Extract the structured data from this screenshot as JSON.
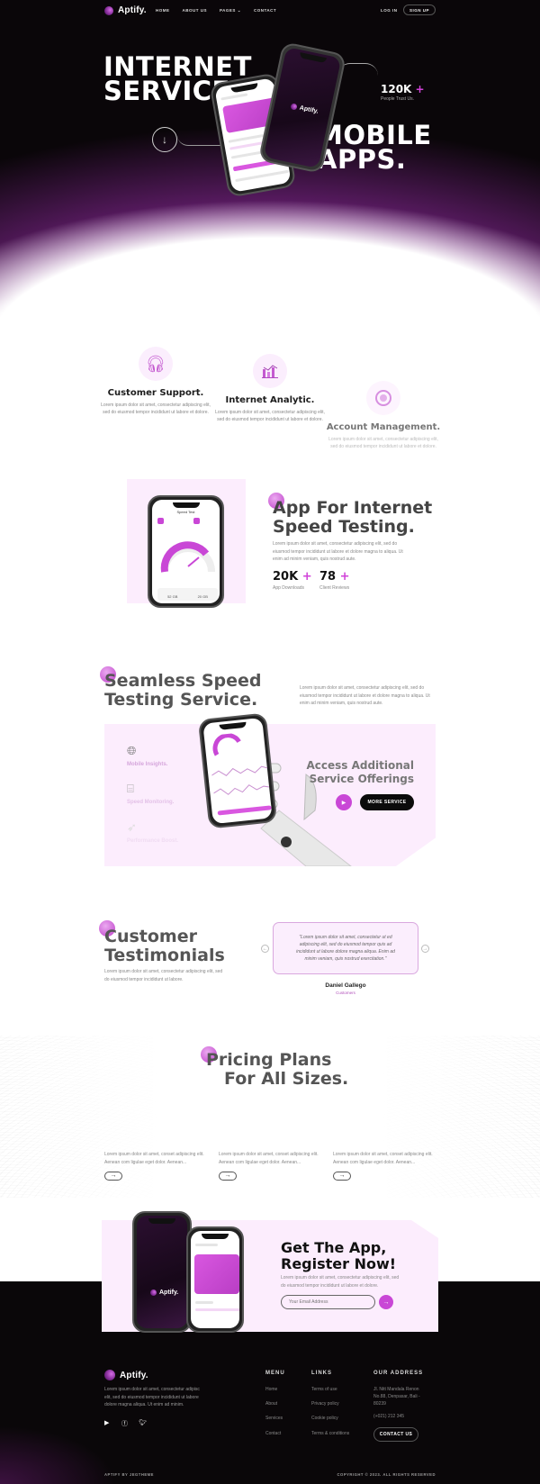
{
  "brand": {
    "name": "Aptify.",
    "accent": "#c947d6",
    "dark": "#0a0609",
    "panel": "#fcedfd"
  },
  "nav": {
    "links": [
      "HOME",
      "ABOUT US",
      "PAGES",
      "CONTACT"
    ],
    "pages_has_dropdown": true,
    "login": "LOG IN",
    "signup": "SIGN UP"
  },
  "hero": {
    "title_line1": "INTERNET",
    "title_line2": "SERVICE",
    "title_line3": "MOBILE",
    "title_line4": "APPS.",
    "stat_value": "120K",
    "stat_plus": "+",
    "stat_label": "People Trust Us.",
    "scroll_icon": "arrow-down-icon",
    "phone_brand": "Aptify."
  },
  "features": [
    {
      "icon": "headset-icon",
      "title": "Customer Support.",
      "desc": "Lorem ipsum dolor sit amet, consectetur adipiscing elit, sed do eiusmod tempor incididunt ut labore et dolore."
    },
    {
      "icon": "analytics-chart-icon",
      "title": "Internet Analytic.",
      "desc": "Lorem ipsum dolor sit amet, consectetur adipiscing elit, sed do eiusmod tempor incididunt ut labore et dolore."
    },
    {
      "icon": "account-coin-icon",
      "title": "Account Management.",
      "desc": "Lorem ipsum dolor sit amet, consectetur adipiscing elit, sed do eiusmod tempor incididunt ut labore et dolore."
    }
  ],
  "speed_app": {
    "title_line1": "App For Internet",
    "title_line2": "Speed Testing.",
    "desc": "Lorem ipsum dolor sit amet, consectetur adipiscing elit, sed do eiusmod tempor incididunt ut labore et dolore magna to aliqua. Ut enim ad minim veniam, quis nostrud aute.",
    "stats": [
      {
        "value": "20K",
        "plus": "+",
        "label": "App Downloads"
      },
      {
        "value": "78",
        "plus": "+",
        "label": "Client Reviews"
      }
    ],
    "phone": {
      "header": "Speed Test",
      "download": "52 GB",
      "upload": "20 GB"
    }
  },
  "seamless": {
    "title_line1": "Seamless Speed",
    "title_line2": "Testing Service.",
    "desc": "Lorem ipsum dolor sit amet, consectetur adipiscing elit, sed do eiusmod tempor incididunt ut labore et dolore magna to aliqua. Ut enim ad minim veniam, quis nostrud aute.",
    "services": [
      {
        "icon": "globe-shield-icon",
        "label": "Mobile Insights.",
        "color": "#d6a6dc"
      },
      {
        "icon": "router-shield-icon",
        "label": "Speed Monitoring.",
        "color": "#e4c2e8"
      },
      {
        "icon": "rocket-icon",
        "label": "Performance Boost.",
        "color": "#f0dcf2"
      }
    ],
    "offer_line1": "Access Additional",
    "offer_line2": "Service Offerings",
    "more_button": "MORE SERVICE"
  },
  "testimonials": {
    "title_line1": "Customer",
    "title_line2": "Testimonials",
    "desc": "Lorem ipsum dolor sit amet, consectetur adipiscing elit, sed do eiusmod tempor incididunt ut labore.",
    "quote": "\"Lorem ipsum dolor sit amet, consectetur ut ed adipiscing elit, sed do eiusmod tempor quis ad incididunt ut labore dolore magna aliqua. Enim ad minim veniam, quis nostrud exercitation.\"",
    "name": "Daniel Gallego",
    "role": "Customers"
  },
  "pricing": {
    "title_line1": "Pricing Plans",
    "title_line2": "For All Sizes.",
    "plans": [
      {
        "desc": "Lorem ipsum dolor sit amet, conset adipiscing elit. Aenean com ligulae eget dolor. Aenean..."
      },
      {
        "desc": "Lorem ipsum dolor sit amet, conset adipiscing elit. Aenean com ligulae eget dolor. Aenean..."
      },
      {
        "desc": "Lorem ipsum dolor sit amet, conset adipiscing elit. Aenean com ligulae eget dolor. Aenean..."
      }
    ],
    "arrow": "→"
  },
  "get_app": {
    "title_line1": "Get The App,",
    "title_line2": "Register Now!",
    "desc": "Lorem ipsum dolor sit amet, consectetur adipiscing elit, sed do eiusmod tempor incididunt ut labore et dolore.",
    "email_placeholder": "Your Email Address",
    "phone_brand": "Aptify."
  },
  "footer": {
    "brand": "Aptify.",
    "desc": "Lorem ipsum dolor sit amet, consectetur adipisc elit, sed do eiusmod tempor incididunt ut labore dolore magna aliqua. Ut enim ad minim.",
    "social": [
      "youtube-icon",
      "facebook-icon",
      "twitter-icon"
    ],
    "menu_title": "MENU",
    "menu": [
      "Home",
      "About",
      "Services",
      "Contact"
    ],
    "links_title": "LINKS",
    "links": [
      "Terms of use",
      "Privacy policy",
      "Cookie policy",
      "Terms & conditions"
    ],
    "address_title": "OUR ADDRESS",
    "address_line1": "Jl. Nitt Mandala Renon",
    "address_line2": "No.88, Denpasar, Bali -",
    "address_line3": "80239",
    "phone": "(+021) 212 345",
    "contact_button": "CONTACT US",
    "credit": "APTIFY BY JEGTHEME",
    "copyright": "COPYRIGHT © 2023. ALL RIGHTS RESERVED"
  }
}
